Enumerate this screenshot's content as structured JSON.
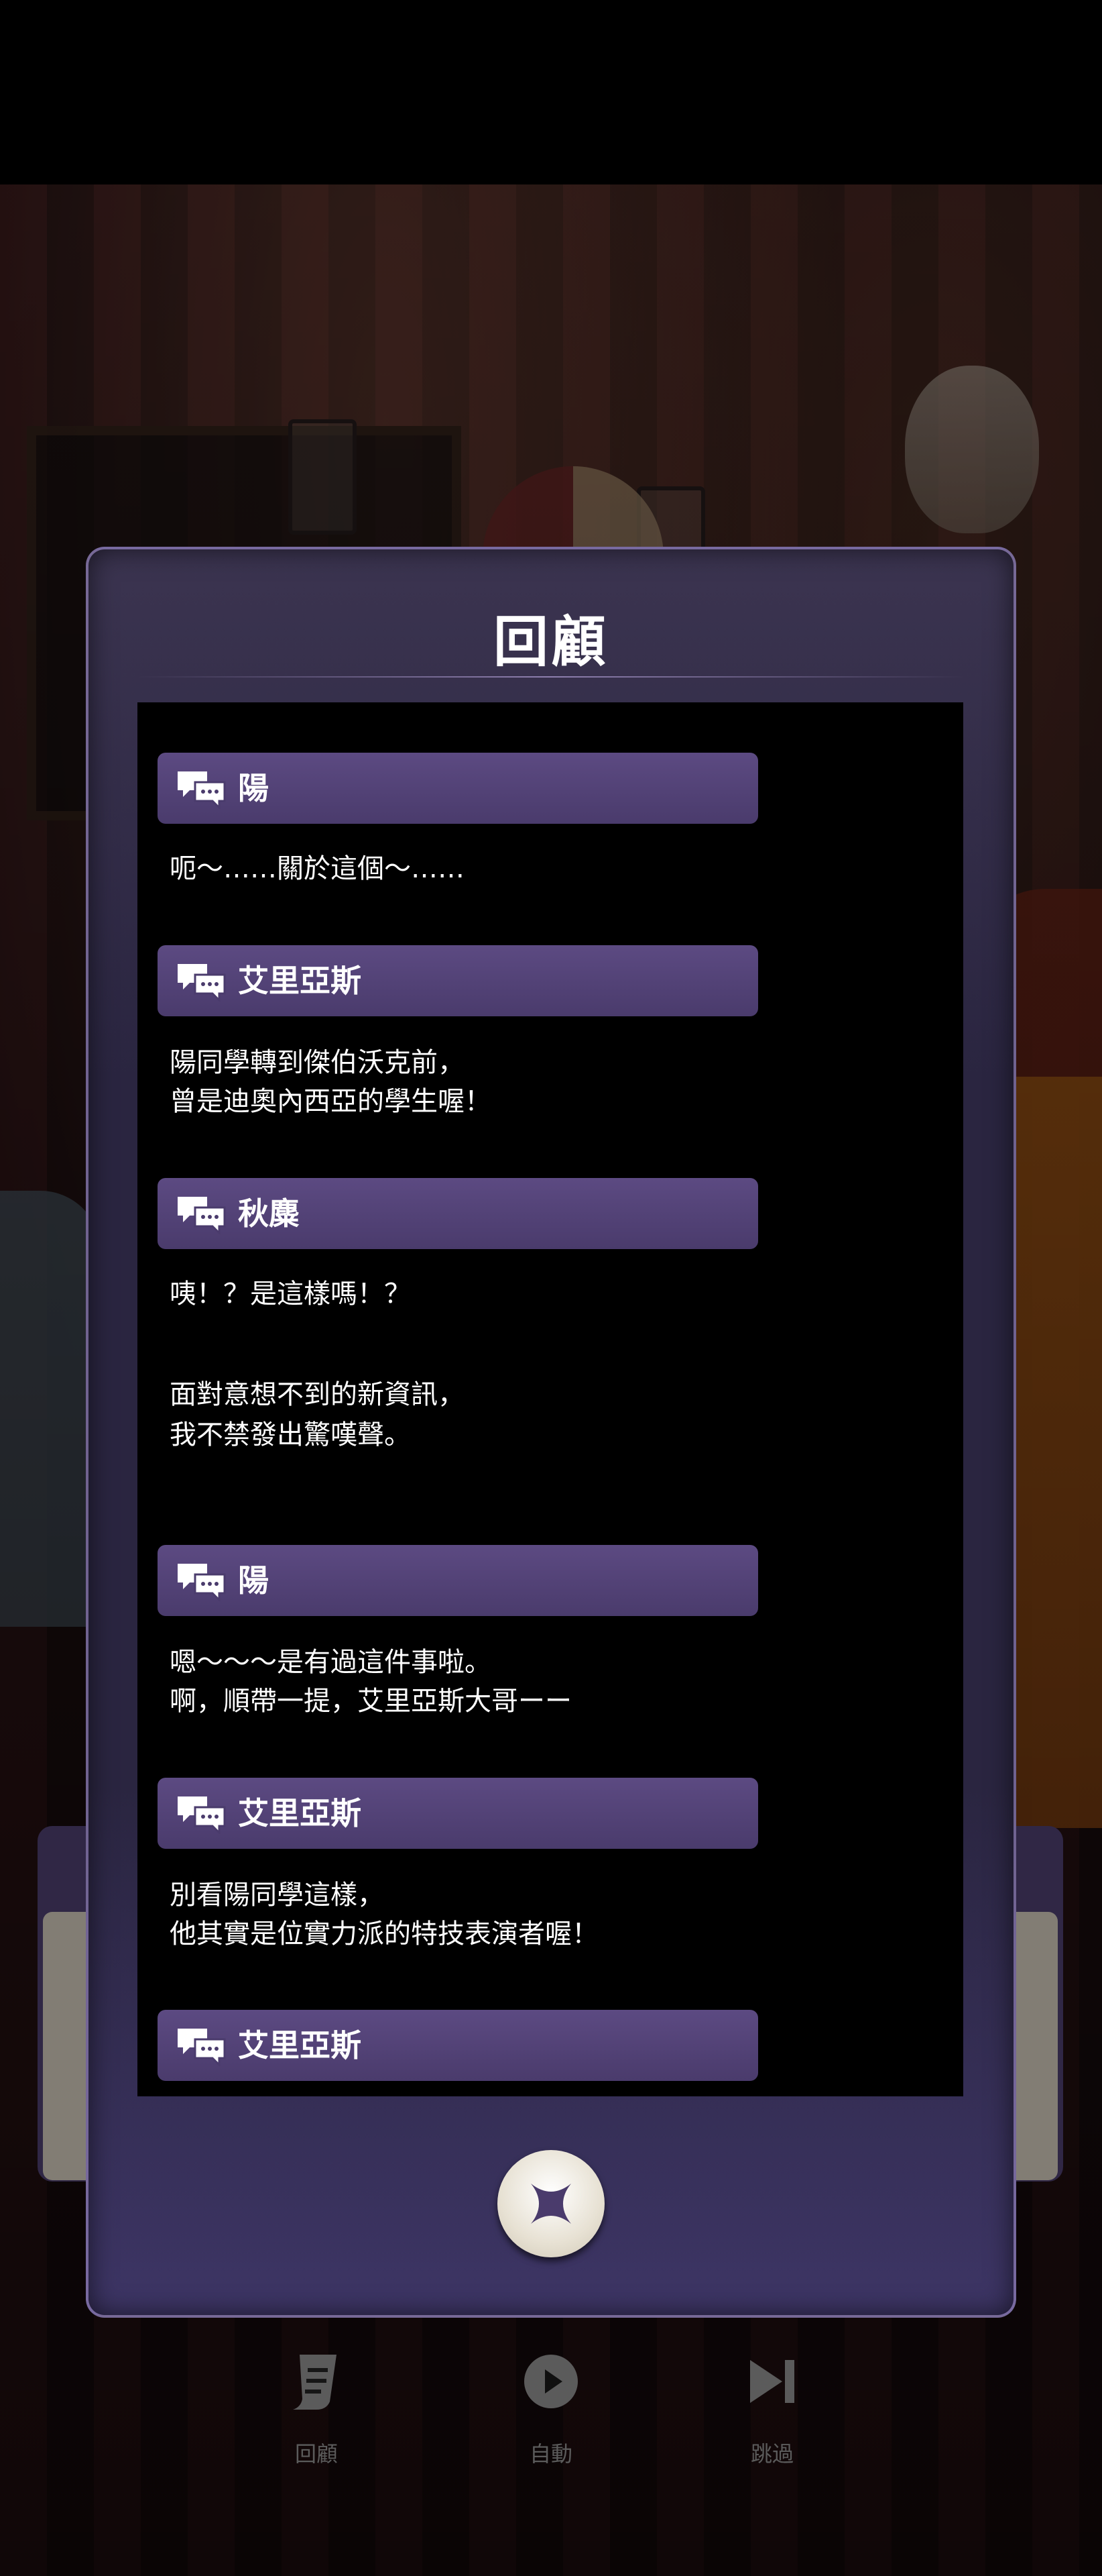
{
  "backlog": {
    "title": "回顧",
    "entries": [
      {
        "speaker": "陽",
        "lines": [
          "呃～……關於這個～……"
        ]
      },
      {
        "speaker": "艾里亞斯",
        "lines": [
          "陽同學轉到傑伯沃克前，",
          "曾是迪奧內西亞的學生喔！"
        ]
      },
      {
        "speaker": "秋麋",
        "lines": [
          "咦！？是這樣嗎！？",
          "面對意想不到的新資訊，",
          "我不禁發出驚嘆聲。"
        ]
      },
      {
        "speaker": "陽",
        "lines": [
          "嗯～～～是有過這件事啦。",
          "啊，順帶一提，艾里亞斯大哥ーー"
        ]
      },
      {
        "speaker": "艾里亞斯",
        "lines": [
          "別看陽同學這樣，",
          "他其實是位實力派的特技表演者喔！"
        ]
      },
      {
        "speaker": "艾里亞斯",
        "lines": []
      }
    ]
  },
  "bottom_bar": {
    "log_label": "回顧",
    "auto_label": "自動",
    "skip_label": "跳過"
  },
  "icons": {
    "entry_icon": "speech-bubbles-icon",
    "close_icon": "close-x-icon",
    "log_icon": "scroll-icon",
    "auto_icon": "play-icon",
    "skip_icon": "skip-forward-icon"
  },
  "colors": {
    "accent": "#4a3b6c",
    "panel": "#2a2540"
  }
}
